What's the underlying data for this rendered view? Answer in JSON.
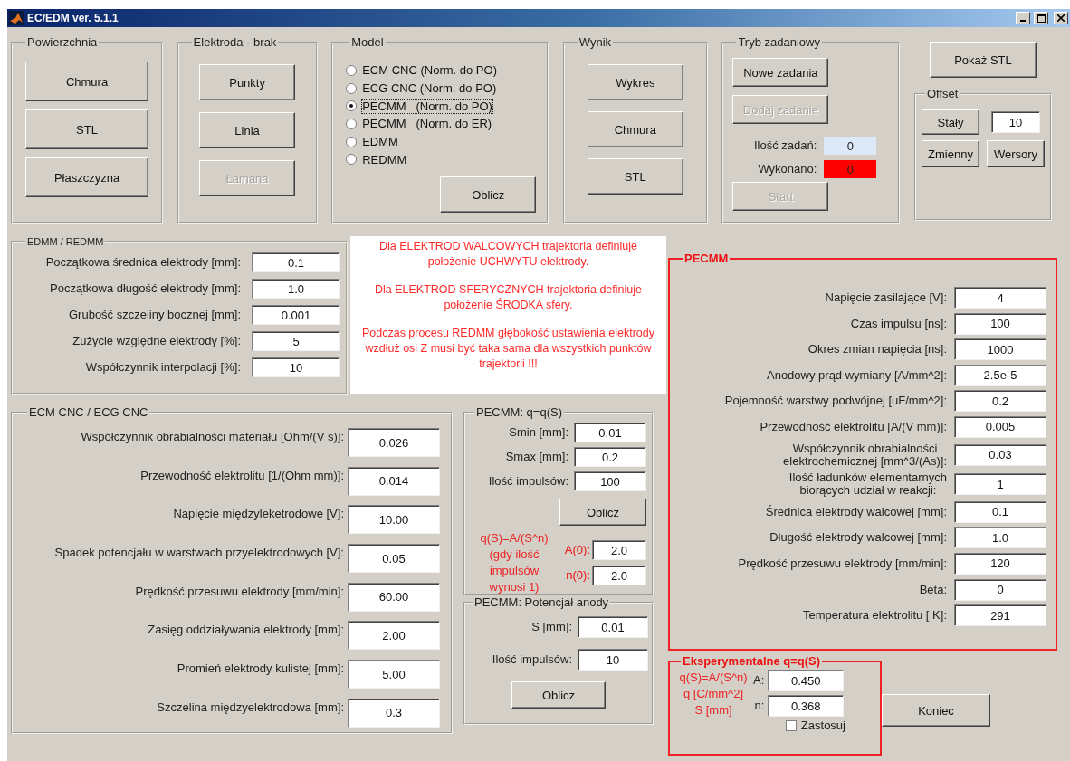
{
  "window": {
    "title": "EC/EDM ver. 5.1.1"
  },
  "powierzchnia": {
    "title": "Powierzchnia",
    "buttons": [
      {
        "label": "Chmura",
        "disabled": false
      },
      {
        "label": "STL",
        "disabled": false
      },
      {
        "label": "Płaszczyzna",
        "disabled": false
      }
    ]
  },
  "elektroda": {
    "title": "Elektroda - brak",
    "buttons": [
      {
        "label": "Punkty",
        "disabled": false
      },
      {
        "label": "Linia",
        "disabled": false
      },
      {
        "label": "Łamana",
        "disabled": true
      }
    ]
  },
  "model": {
    "title": "Model",
    "options": [
      {
        "label": "ECM CNC (Norm. do PO)",
        "selected": false
      },
      {
        "label": "ECG CNC (Norm. do PO)",
        "selected": false
      },
      {
        "label": "PECMM   (Norm. do PO)",
        "selected": true
      },
      {
        "label": "PECMM   (Norm. do ER)",
        "selected": false
      },
      {
        "label": "EDMM",
        "selected": false
      },
      {
        "label": "REDMM",
        "selected": false
      }
    ],
    "button": {
      "label": "Oblicz",
      "disabled": false
    }
  },
  "wynik": {
    "title": "Wynik",
    "buttons": [
      {
        "label": "Wykres",
        "disabled": false
      },
      {
        "label": "Chmura",
        "disabled": false
      },
      {
        "label": "STL",
        "disabled": false
      }
    ]
  },
  "tryb": {
    "title": "Tryb zadaniowy",
    "buttons": [
      {
        "label": "Nowe zadania",
        "disabled": false
      },
      {
        "label": "Dodaj zadanie",
        "disabled": true
      }
    ],
    "counters": [
      {
        "label": "Ilość zadań:",
        "value": "0",
        "color": "#dde9f8"
      },
      {
        "label": "Wykonano:",
        "value": "0",
        "color": "#ff0000"
      }
    ],
    "start": {
      "label": "Start",
      "disabled": true
    }
  },
  "show_stl": {
    "label": "Pokaż STL",
    "disabled": false
  },
  "offset": {
    "title": "Offset",
    "items": [
      {
        "kind": "button",
        "label": "Stały"
      },
      {
        "kind": "field",
        "value": "10"
      },
      {
        "kind": "button",
        "label": "Zmienny"
      },
      {
        "kind": "button",
        "label": "Wersory"
      }
    ]
  },
  "edmm": {
    "title": "EDMM / REDMM",
    "fields": [
      {
        "label": "Początkowa średnica elektrody [mm]:",
        "value": "0.1"
      },
      {
        "label": "Początkowa długość elektrody [mm]:",
        "value": "1.0"
      },
      {
        "label": "Grubość szczeliny bocznej [mm]:",
        "value": "0.001"
      },
      {
        "label": "Zużycie względne elektrody [%]:",
        "value": "5"
      },
      {
        "label": "Współczynnik interpolacji [%]:",
        "value": "10"
      }
    ]
  },
  "notice": {
    "paragraphs": [
      "Dla ELEKTROD WALCOWYCH trajektoria definiuje położenie UCHWYTU elektrody.",
      "Dla ELEKTROD SFERYCZNYCH  trajektoria definiuje położenie ŚRODKA sfery.",
      "Podczas procesu REDMM głębokość ustawienia elektrody wzdłuż osi Z musi być taka sama dla wszystkich punktów trajektorii !!!"
    ]
  },
  "ecm": {
    "title": "ECM CNC / ECG CNC",
    "fields": [
      {
        "label": "Współczynnik obrabialności materiału [Ohm/(V s)]:",
        "value": "0.026"
      },
      {
        "label": "Przewodność elektrolitu [1/(Ohm mm)]:",
        "value": "0.014"
      },
      {
        "label": "Napięcie międzyleketrodowe [V]:",
        "value": "10.00"
      },
      {
        "label": "Spadek potencjału w warstwach przyelektrodowych [V]:",
        "value": "0.05"
      },
      {
        "label": "Prędkość przesuwu elektrody [mm/min]:",
        "value": "60.00"
      },
      {
        "label": "Zasięg oddziaływania elektrody [mm]:",
        "value": "2.00"
      },
      {
        "label": "Promień elektrody kulistej [mm]:",
        "value": "5.00"
      },
      {
        "label": "Szczelina międzyelektrodowa [mm]:",
        "value": "0.3"
      }
    ]
  },
  "pecmm_q": {
    "title": "PECMM: q=q(S)",
    "fields": [
      {
        "label": "Smin [mm]:",
        "value": "0.01"
      },
      {
        "label": "Smax [mm]:",
        "value": "0.2"
      },
      {
        "label": "Ilość impulsów:",
        "value": "100"
      }
    ],
    "button": {
      "label": "Oblicz",
      "disabled": false
    },
    "formula": "q(S)=A/(S^n) (gdy ilość impulsów wynosi 1)",
    "params": [
      {
        "label": "A(0):",
        "value": "2.0"
      },
      {
        "label": "n(0):",
        "value": "2.0"
      }
    ]
  },
  "pecmm_anode": {
    "title": "PECMM: Potencjał anody",
    "fields": [
      {
        "label": "S [mm]:",
        "value": "0.01"
      },
      {
        "label": "Ilość impulsów:",
        "value": "10"
      }
    ],
    "button": {
      "label": "Oblicz",
      "disabled": false
    }
  },
  "pecmm": {
    "title": "PECMM",
    "fields": [
      {
        "label": [
          "Napięcie zasilające [V]:"
        ],
        "value": "4"
      },
      {
        "label": [
          "Czas impulsu [ns]:"
        ],
        "value": "100"
      },
      {
        "label": [
          "Okres zmian napięcia [ns]:"
        ],
        "value": "1000"
      },
      {
        "label": [
          "Anodowy prąd wymiany [A/mm^2]:"
        ],
        "value": "2.5e-5"
      },
      {
        "label": [
          "Pojemność warstwy podwójnej [uF/mm^2]:"
        ],
        "value": "0.2"
      },
      {
        "label": [
          "Przewodność elektrolitu [A/(V mm)]:"
        ],
        "value": "0.005"
      },
      {
        "label": [
          "Współczynnik obrabialności",
          "elektrochemicznej [mm^3/(As)]:"
        ],
        "value": "0.03"
      },
      {
        "label": [
          "Ilość ładunków elementarnych",
          "biorących udział w reakcji:"
        ],
        "value": "1"
      },
      {
        "label": [
          "Średnica elektrody walcowej [mm]:"
        ],
        "value": "0.1"
      },
      {
        "label": [
          "Długość elektrody walcowej [mm]:"
        ],
        "value": "1.0"
      },
      {
        "label": [
          "Prędkość przesuwu elektrody [mm/min]:"
        ],
        "value": "120"
      },
      {
        "label": [
          "Beta:"
        ],
        "value": "0"
      },
      {
        "label": [
          "Temperatura elektrolitu [ K]:"
        ],
        "value": "291"
      }
    ]
  },
  "experimental": {
    "title": "Eksperymentalne q=q(S)",
    "formula": [
      "q(S)=A/(S^n)",
      "q [C/mm^2]",
      "S [mm]"
    ],
    "fields": [
      {
        "label": "A:",
        "value": "0.450"
      },
      {
        "label": "n:",
        "value": "0.368"
      }
    ],
    "checkbox": {
      "label": "Zastosuj",
      "checked": false
    }
  },
  "exit_button": {
    "label": "Koniec",
    "disabled": false
  }
}
